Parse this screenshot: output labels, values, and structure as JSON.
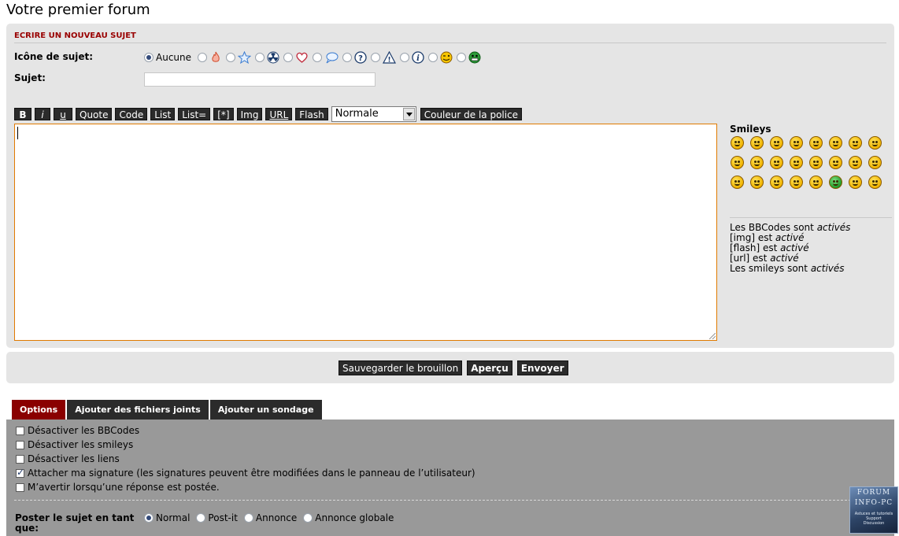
{
  "page": {
    "title": "Votre premier forum"
  },
  "compose": {
    "section_title": "ECRIRE UN NOUVEAU SUJET",
    "topic_icon_label": "Icône de sujet:",
    "no_icon_label": "Aucune",
    "topic_icons": [
      "fire-icon",
      "star-icon",
      "radioactive-icon",
      "heart-icon",
      "speech-bubble-icon",
      "question-icon",
      "warning-icon",
      "info-icon",
      "wink-smiley-icon",
      "grin-smiley-icon"
    ],
    "subject_label": "Sujet:",
    "subject_value": ""
  },
  "toolbar": {
    "bold": "B",
    "italic": "i",
    "underline": "u",
    "quote": "Quote",
    "code": "Code",
    "list": "List",
    "list_eq": "List=",
    "list_item": "[*]",
    "img": "Img",
    "url": "URL",
    "flash": "Flash",
    "font_size": "Normale",
    "font_color": "Couleur de la police"
  },
  "smileys": {
    "title": "Smileys",
    "items": [
      "biggrin",
      "happy",
      "smile",
      "neutral",
      "surprised",
      "eek",
      "rolleyes",
      "cool",
      "razz",
      "mad",
      "tongue",
      "confused",
      "frown",
      "evil",
      "twisted",
      "shocked",
      "exclaim",
      "question",
      "idea",
      "arrow",
      "sad",
      "green",
      "geek",
      "nerd"
    ],
    "status": [
      {
        "prefix": "Les BBCodes sont ",
        "emph": "activés"
      },
      {
        "prefix": "[img] est ",
        "emph": "activé"
      },
      {
        "prefix": "[flash] est ",
        "emph": "activé"
      },
      {
        "prefix": "[url] est ",
        "emph": "activé"
      },
      {
        "prefix": "Les smileys sont ",
        "emph": "activés"
      }
    ]
  },
  "submit": {
    "save_draft": "Sauvegarder le brouillon",
    "preview": "Aperçu",
    "send": "Envoyer"
  },
  "tabs": [
    {
      "label": "Options",
      "active": true
    },
    {
      "label": "Ajouter des fichiers joints",
      "active": false
    },
    {
      "label": "Ajouter un sondage",
      "active": false
    }
  ],
  "options": [
    {
      "label": "Désactiver les BBCodes",
      "checked": false
    },
    {
      "label": "Désactiver les smileys",
      "checked": false
    },
    {
      "label": "Désactiver les liens",
      "checked": false
    },
    {
      "label": "Attacher ma signature (les signatures peuvent être modifiées dans le panneau de l’utilisateur)",
      "checked": true
    },
    {
      "label": "M’avertir lorsqu’une réponse est postée.",
      "checked": false
    }
  ],
  "post_type": {
    "label": "Poster le sujet en tant que:",
    "options": [
      "Normal",
      "Post-it",
      "Annonce",
      "Annonce globale"
    ],
    "selected": "Normal"
  },
  "badge": {
    "line1": "FORUM",
    "line2": "INFO-PC",
    "line3": "Astuces et tutoriels",
    "line4": "Support",
    "line5": "Discussion"
  },
  "colors": {
    "accent_red": "#990000",
    "tab_active": "#8a0000",
    "editor_border": "#e07a00"
  }
}
